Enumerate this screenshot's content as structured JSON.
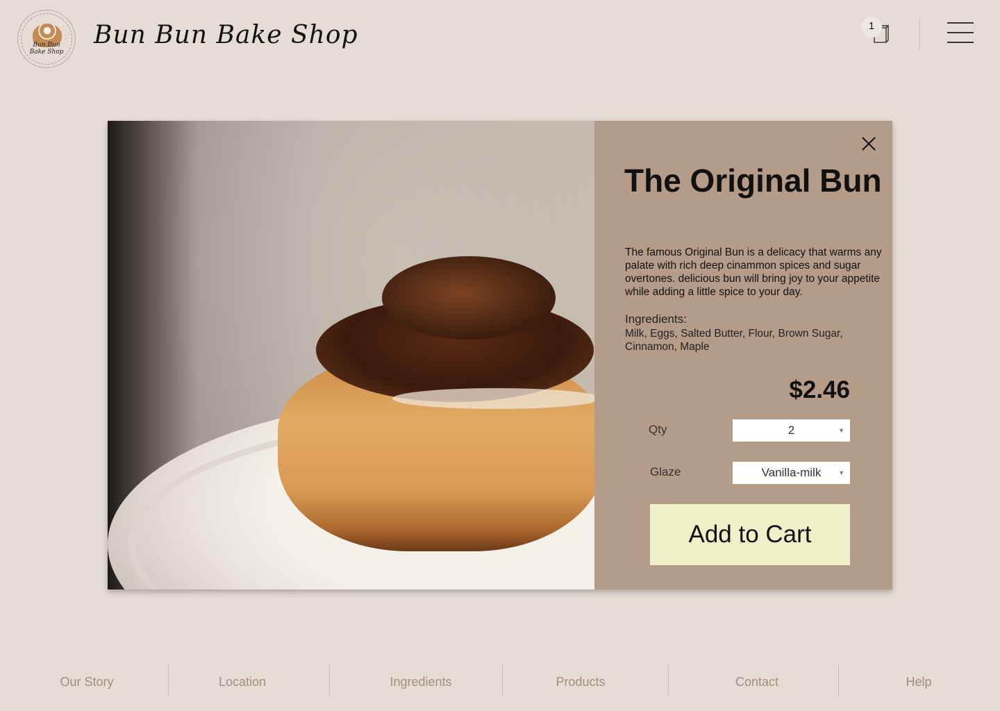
{
  "brand": {
    "logo_text_line1": "Bun Bun",
    "logo_text_line2": "Bake Shop",
    "name": "Bun Bun Bake Shop"
  },
  "header": {
    "cart_count": "1",
    "cart_icon": "shopping-bag-icon",
    "menu_icon": "hamburger-menu-icon"
  },
  "product": {
    "title": "The Original Bun",
    "description": "The famous Original Bun is a delicacy that warms any palate with rich deep cinammon spices and sugar overtones. delicious bun will bring joy to your appetite while adding a little spice to your day.",
    "ingredients_label": "Ingredients:",
    "ingredients": "Milk, Eggs, Salted Butter, Flour, Brown Sugar, Cinnamon, Maple",
    "price": "$2.46",
    "qty_label": "Qty",
    "qty_value": "2",
    "glaze_label": "Glaze",
    "glaze_value": "Vanilla-milk",
    "add_to_cart": "Add to Cart"
  },
  "footer": {
    "items": [
      "Our Story",
      "Location",
      "Ingredients",
      "Products",
      "Contact",
      "Help"
    ]
  },
  "colors": {
    "page_bg": "#e5dcd5",
    "panel_bg": "#b59c88",
    "button_bg": "#efefc8",
    "nav_text": "#a38e7c"
  }
}
